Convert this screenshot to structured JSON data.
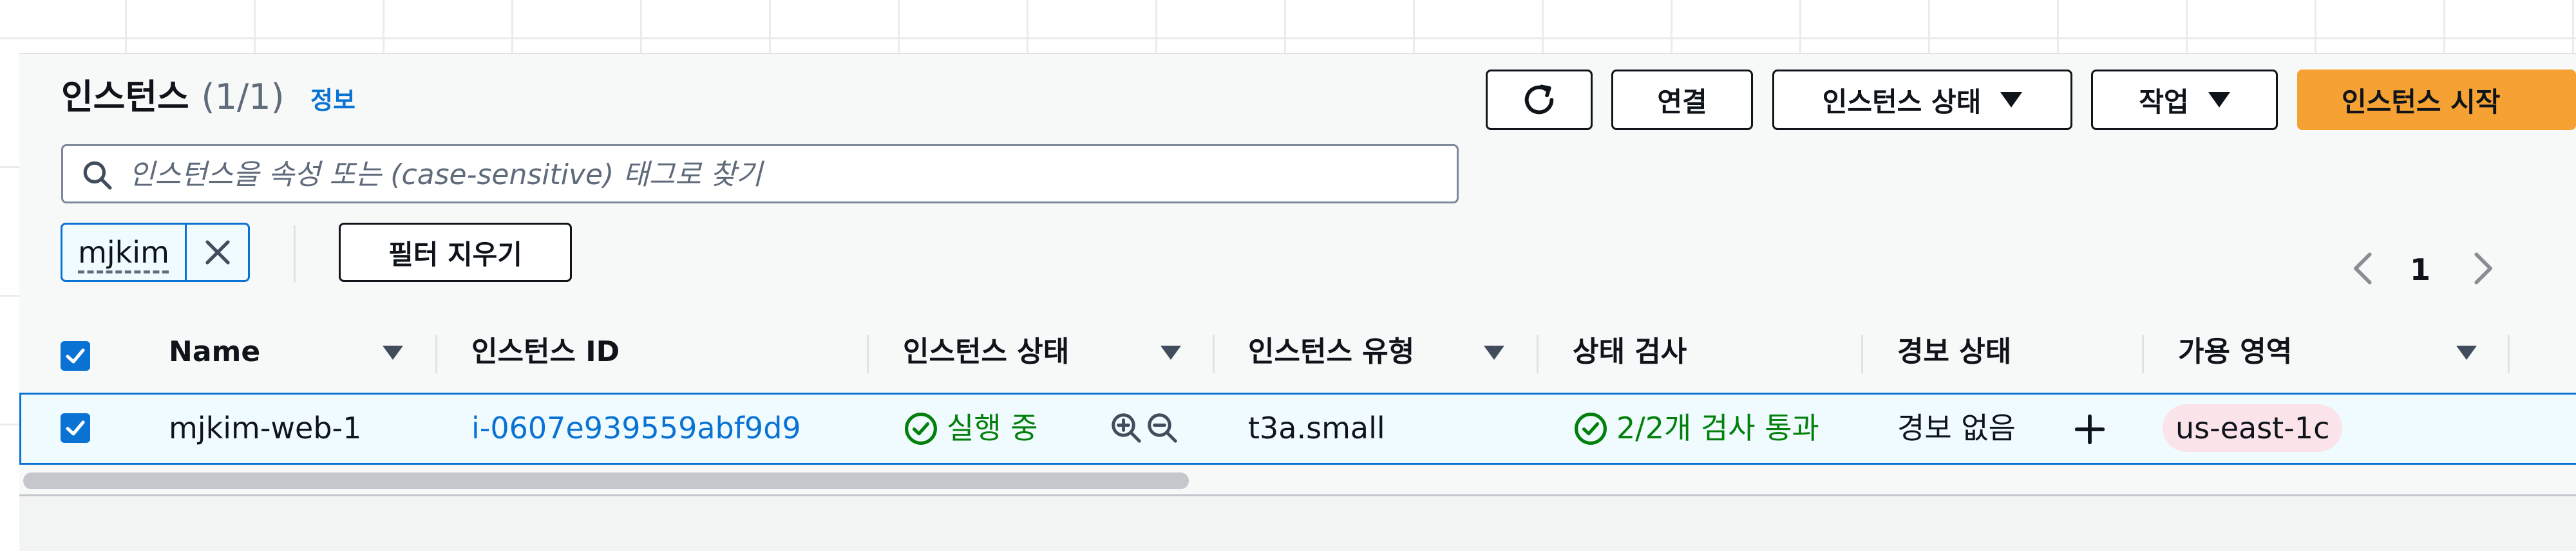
{
  "header": {
    "title": "인스턴스",
    "count": "(1/1)",
    "info_link": "정보",
    "buttons": {
      "connect": "연결",
      "instance_state": "인스턴스 상태",
      "actions": "작업",
      "launch": "인스턴스 시작"
    }
  },
  "search": {
    "placeholder": "인스턴스을 속성 또는 (case-sensitive) 태그로 찾기",
    "value": ""
  },
  "filter": {
    "token": "mjkim",
    "clear_label": "필터 지우기"
  },
  "pagination": {
    "current_page": "1"
  },
  "table": {
    "columns": [
      "Name",
      "인스턴스 ID",
      "인스턴스 상태",
      "인스턴스 유형",
      "상태 검사",
      "경보 상태",
      "가용 영역"
    ],
    "rows": [
      {
        "name": "mjkim-web-1",
        "instance_id": "i-0607e939559abf9d9",
        "state": "실행 중",
        "type": "t3a.small",
        "status_check": "2/2개 검사 통과",
        "alarm": "경보 없음",
        "zone": "us-east-1c"
      }
    ]
  },
  "colors": {
    "accent": "#0972d3",
    "primary_button": "#f5a133",
    "success": "#037f0c",
    "zone_badge": "#fbe3ea"
  },
  "icons": [
    "refresh-icon",
    "search-icon",
    "close-icon",
    "chevron-left-icon",
    "chevron-right-icon",
    "sort-down-icon",
    "check-circle-icon",
    "zoom-in-icon",
    "zoom-out-icon",
    "plus-icon",
    "checkmark-icon"
  ]
}
